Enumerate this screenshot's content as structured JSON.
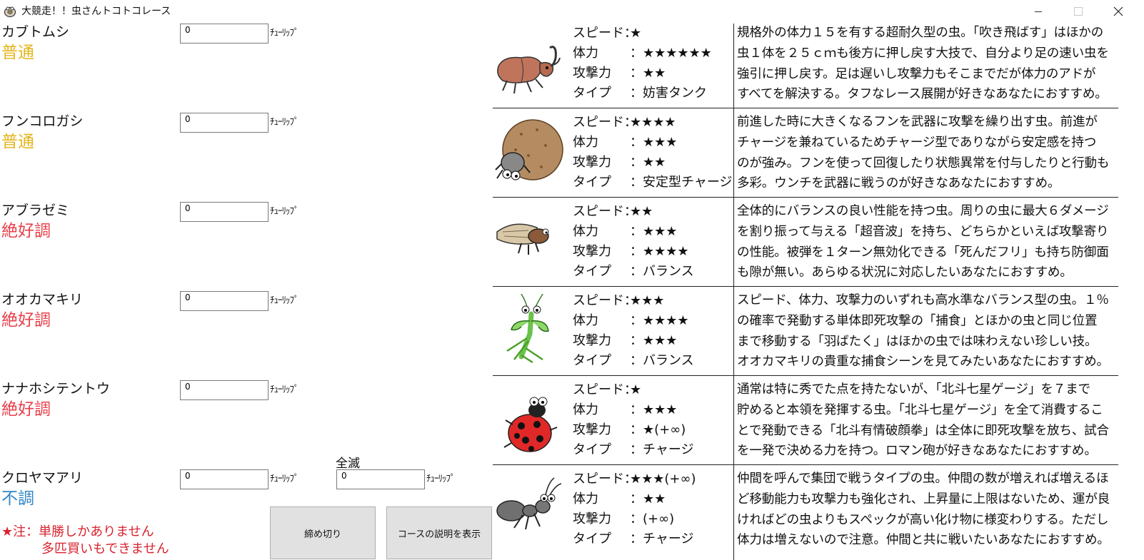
{
  "window": {
    "title": "大競走！！虫さんトコトコレース"
  },
  "unit_label": "ﾁｭｰﾘｯﾌﾟ",
  "bugs": [
    {
      "name": "カブトムシ",
      "condition": "普通",
      "condition_color": "#e3b51b",
      "bet_value": "0"
    },
    {
      "name": "フンコロガシ",
      "condition": "普通",
      "condition_color": "#e3b51b",
      "bet_value": "0"
    },
    {
      "name": "アブラゼミ",
      "condition": "絶好調",
      "condition_color": "#e8404a",
      "bet_value": "0"
    },
    {
      "name": "オオカマキリ",
      "condition": "絶好調",
      "condition_color": "#e8404a",
      "bet_value": "0"
    },
    {
      "name": "ナナホシテントウ",
      "condition": "絶好調",
      "condition_color": "#e8404a",
      "bet_value": "0"
    },
    {
      "name": "クロヤマアリ",
      "condition": "不調",
      "condition_color": "#2f86c6",
      "bet_value": "0"
    }
  ],
  "zenmetsu": {
    "label": "全滅",
    "value": "0"
  },
  "note": {
    "line1": "★注：単勝しかありません",
    "line2": "多匹買いもできません"
  },
  "buttons": {
    "close_bets": "締め切り",
    "show_course": "コースの説明を表示"
  },
  "stat_labels": {
    "speed": "スピード：",
    "hp": "体力",
    "attack": "攻撃力",
    "type": "タイプ"
  },
  "profiles": [
    {
      "speed": "★",
      "hp": "：★★★★★★",
      "attack": "：★★",
      "type": "：妨害タンク",
      "desc": [
        "規格外の体力１５を有する超耐久型の虫。「吹き飛ばす」はほかの",
        "虫１体を２５ｃｍも後方に押し戻す大技で、自分より足の速い虫を",
        "強引に押し戻す。足は遅いし攻撃力もそこまでだが体力のアドが",
        "すべてを解決する。タフなレース展開が好きなあなたにおすすめ。"
      ]
    },
    {
      "speed": "★★★★",
      "hp": "：★★★",
      "attack": "：★★",
      "type": "：安定型チャージ",
      "desc": [
        "前進した時に大きくなるフンを武器に攻撃を繰り出す虫。前進が",
        "チャージを兼ねているためチャージ型でありながら安定感を持つ",
        "のが強み。フンを使って回復したり状態異常を付与したりと行動も",
        "多彩。ウンチを武器に戦うのが好きなあなたにおすすめ。"
      ]
    },
    {
      "speed": "★★",
      "hp": "：★★★",
      "attack": "：★★★★",
      "type": "：バランス",
      "desc": [
        "全体的にバランスの良い性能を持つ虫。周りの虫に最大６ダメージ",
        "を割り振って与える「超音波」を持ち、どちらかといえば攻撃寄り",
        "の性能。被弾を１ターン無効化できる「死んだフリ」も持ち防御面",
        "も隙が無い。あらゆる状況に対応したいあなたにおすすめ。"
      ]
    },
    {
      "speed": "★★★",
      "hp": "：★★★★",
      "attack": "：★★★",
      "type": "：バランス",
      "desc": [
        "スピード、体力、攻撃力のいずれも高水準なバランス型の虫。１％",
        "の確率で発動する単体即死攻撃の「捕食」とほかの虫と同じ位置",
        "まで移動する「羽ばたく」はほかの虫では味わえない珍しい技。",
        "オオカマキリの貴重な捕食シーンを見てみたいあなたにおすすめ。"
      ]
    },
    {
      "speed": "★",
      "hp": "：★★★",
      "attack": "：★(+∞)",
      "type": "：チャージ",
      "desc": [
        "通常は特に秀でた点を持たないが、「北斗七星ゲージ」を７まで",
        "貯めると本領を発揮する虫。「北斗七星ゲージ」を全て消費するこ",
        "とで発動できる「北斗有情破顔拳」は全体に即死攻撃を放ち、試合",
        "を一発で決める力を持つ。ロマン砲が好きなあなたにおすすめ。"
      ]
    },
    {
      "speed": "★★★(+∞)",
      "hp": "：★★",
      "attack": "：(+∞)",
      "type": "：チャージ",
      "desc": [
        "仲間を呼んで集団で戦うタイプの虫。仲間の数が増えれば増えるほ",
        "ど移動能力も攻撃力も強化され、上昇量に上限はないため、運が良",
        "ければどの虫よりもスペックが高い化け物に様変わりする。ただし",
        "体力は増えないので注意。仲間と共に戦いたいあなたにおすすめ。"
      ]
    }
  ]
}
